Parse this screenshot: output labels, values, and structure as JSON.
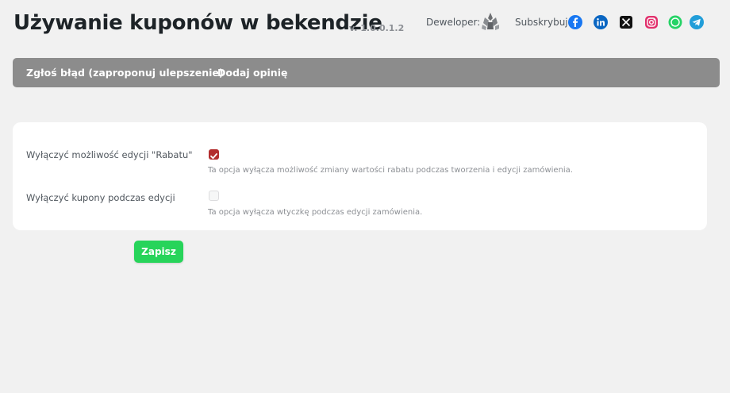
{
  "header": {
    "title": "Używanie kuponów w bekendzie",
    "version": "v. 1.0.0.1.2",
    "developer_label": "Deweloper:",
    "subscribe_label": "Subskrybuj:",
    "social": [
      "facebook-icon",
      "linkedin-icon",
      "x-icon",
      "instagram-icon",
      "whatsapp-icon",
      "telegram-icon"
    ]
  },
  "nav": {
    "report": "Zgłoś błąd (zaproponuj ulepszenie)",
    "review": "Dodaj opinię"
  },
  "settings": [
    {
      "label": "Wyłączyć możliwość edycji \"Rabatu\"",
      "checked": true,
      "description": "Ta opcja wyłącza możliwość zmiany wartości rabatu podczas tworzenia i edycji zamówienia."
    },
    {
      "label": "Wyłączyć kupony podczas edycji",
      "checked": false,
      "description": "Ta opcja wyłącza wtyczkę podczas edycji zamówienia."
    }
  ],
  "save_label": "Zapisz",
  "colors": {
    "accent": "#b32d2e",
    "save": "#27d45a",
    "nav": "#8c8c8c"
  }
}
